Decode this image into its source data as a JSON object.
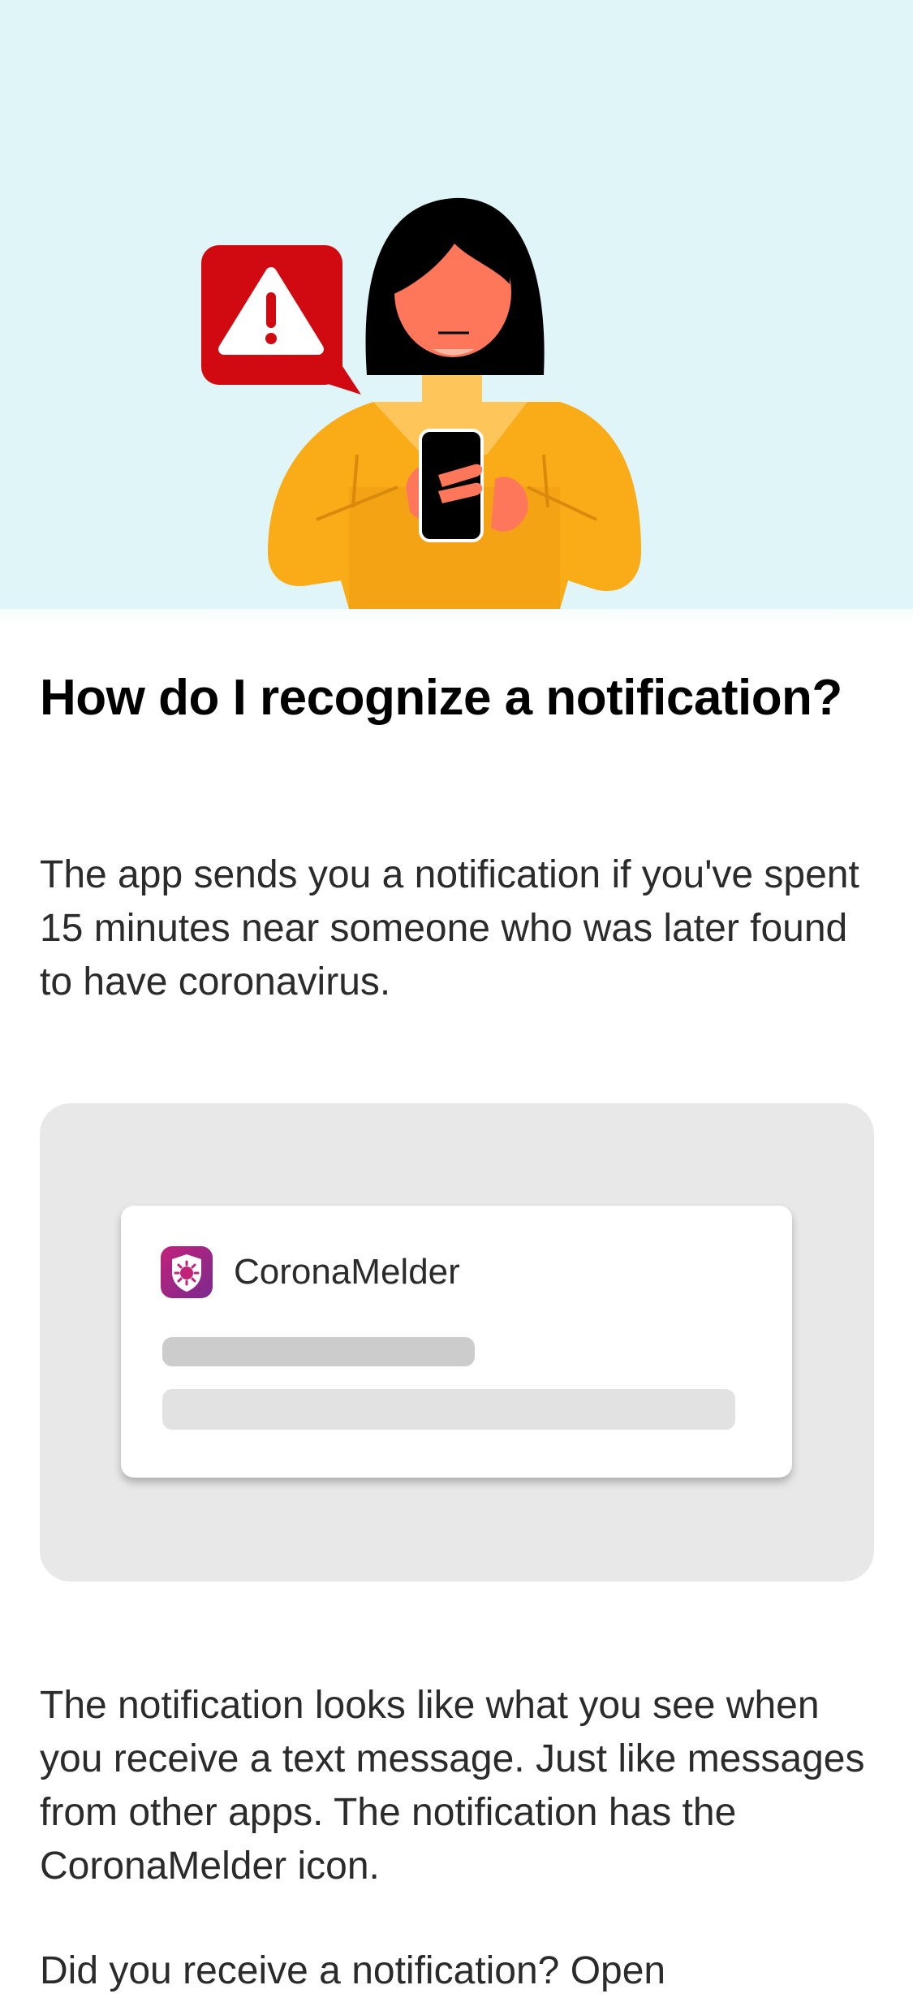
{
  "header": {
    "title": "How do I recognize a notification?"
  },
  "intro": "The app sends you a notification if you've spent 15 minutes near someone who was later found to have coronavirus.",
  "notification_preview": {
    "app_name": "CoronaMelder",
    "icon": "coronamelder-shield-icon"
  },
  "hero": {
    "icon": "warning-speech-bubble-icon",
    "background_color": "#e0f5f8",
    "alert_color": "#d10a11"
  },
  "body": {
    "paragraph1": "The notification looks like what you see when you receive a text message. Just like messages from other apps. The notification has the CoronaMelder icon.",
    "paragraph2": "Did you receive a notification? Open"
  }
}
